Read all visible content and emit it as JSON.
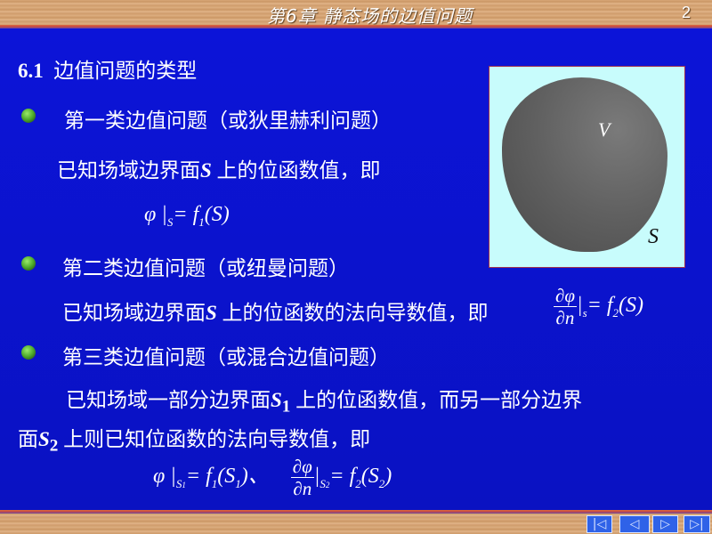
{
  "header": {
    "title": "第6章  静态场的边值问题",
    "page_number": "2"
  },
  "section": {
    "number": "6.1",
    "title": "边值问题的类型"
  },
  "items": [
    {
      "heading": "第一类边值问题（或狄里赫利问题）",
      "desc_pre": "已知场域边界面",
      "desc_var": "S",
      "desc_post": " 上的位函数值，即",
      "formula": {
        "lhs": "φ",
        "sub": "S",
        "rhs": "= f",
        "rhs_sub": "1",
        "arg": "(S)"
      }
    },
    {
      "heading": "第二类边值问题（或纽曼问题）",
      "desc_pre": "已知场域边界面",
      "desc_var": "S",
      "desc_post": " 上的位函数的法向导数值，即",
      "formula": {
        "num": "∂φ",
        "den": "∂n",
        "sub": "s",
        "rhs": "= f",
        "rhs_sub": "2",
        "arg": "(S)"
      }
    },
    {
      "heading": "第三类边值问题（或混合边值问题）",
      "line1_pre": "已知场域一部分边界面",
      "line1_var": "S",
      "line1_sub": "1",
      "line1_post": " 上的位函数值，而另一部分边界",
      "line2_pre": "面",
      "line2_var": "S",
      "line2_sub": "2",
      "line2_post": " 上则已知位函数的法向导数值，即",
      "formula": {
        "lhs": "φ",
        "sub1": "S",
        "sub1_idx": "1",
        "eq1": "= f",
        "eq1_sub": "1",
        "arg1": "(S",
        "arg1_sub": "1",
        "arg1_end": ")、",
        "num": "∂φ",
        "den": "∂n",
        "sub2": "S",
        "sub2_idx": "2",
        "eq2": "= f",
        "eq2_sub": "2",
        "arg2": "(S",
        "arg2_sub": "2",
        "arg2_end": ")"
      }
    }
  ],
  "figure": {
    "volume_label": "V",
    "surface_label": "S"
  },
  "nav": {
    "first": "|◁",
    "prev": "◁",
    "next": "▷",
    "last": "▷|"
  },
  "colors": {
    "background": "#0a10c8",
    "bullet": "#4caa2a",
    "figure_bg": "#c8fcfc",
    "nav_button": "#2f62e8"
  }
}
